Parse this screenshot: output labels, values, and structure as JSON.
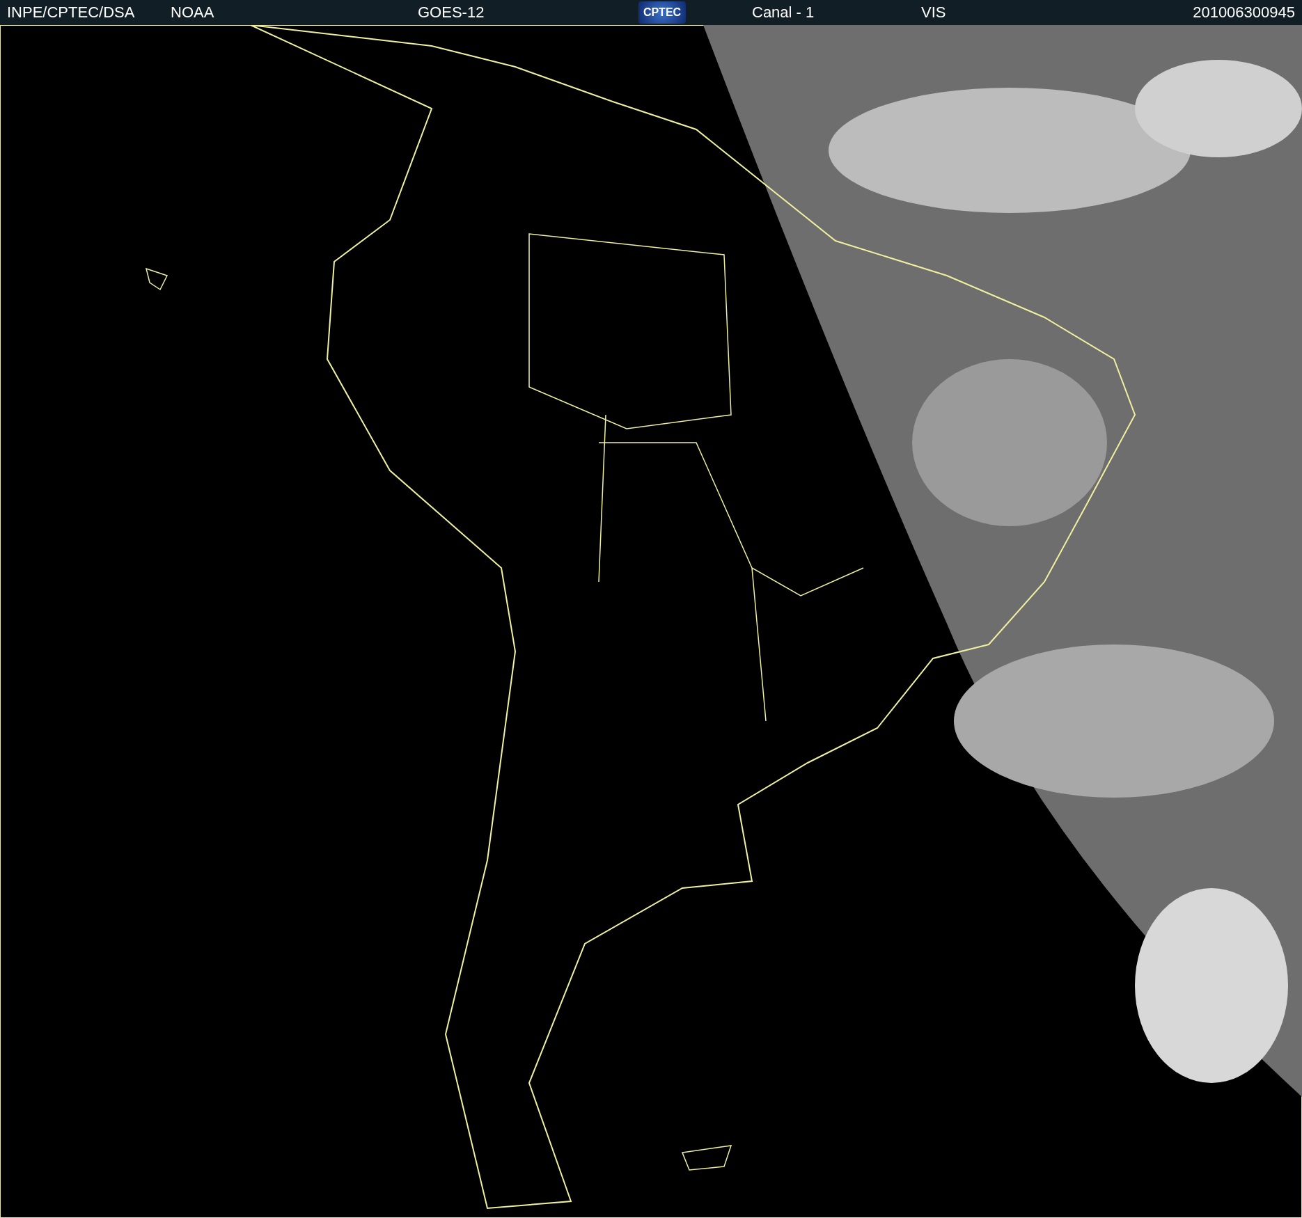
{
  "header": {
    "source": "INPE/CPTEC/DSA",
    "agency": "NOAA",
    "satellite": "GOES-12",
    "logo": "CPTEC",
    "channel": "Canal - 1",
    "band": "VIS",
    "timestamp": "201006300945"
  }
}
